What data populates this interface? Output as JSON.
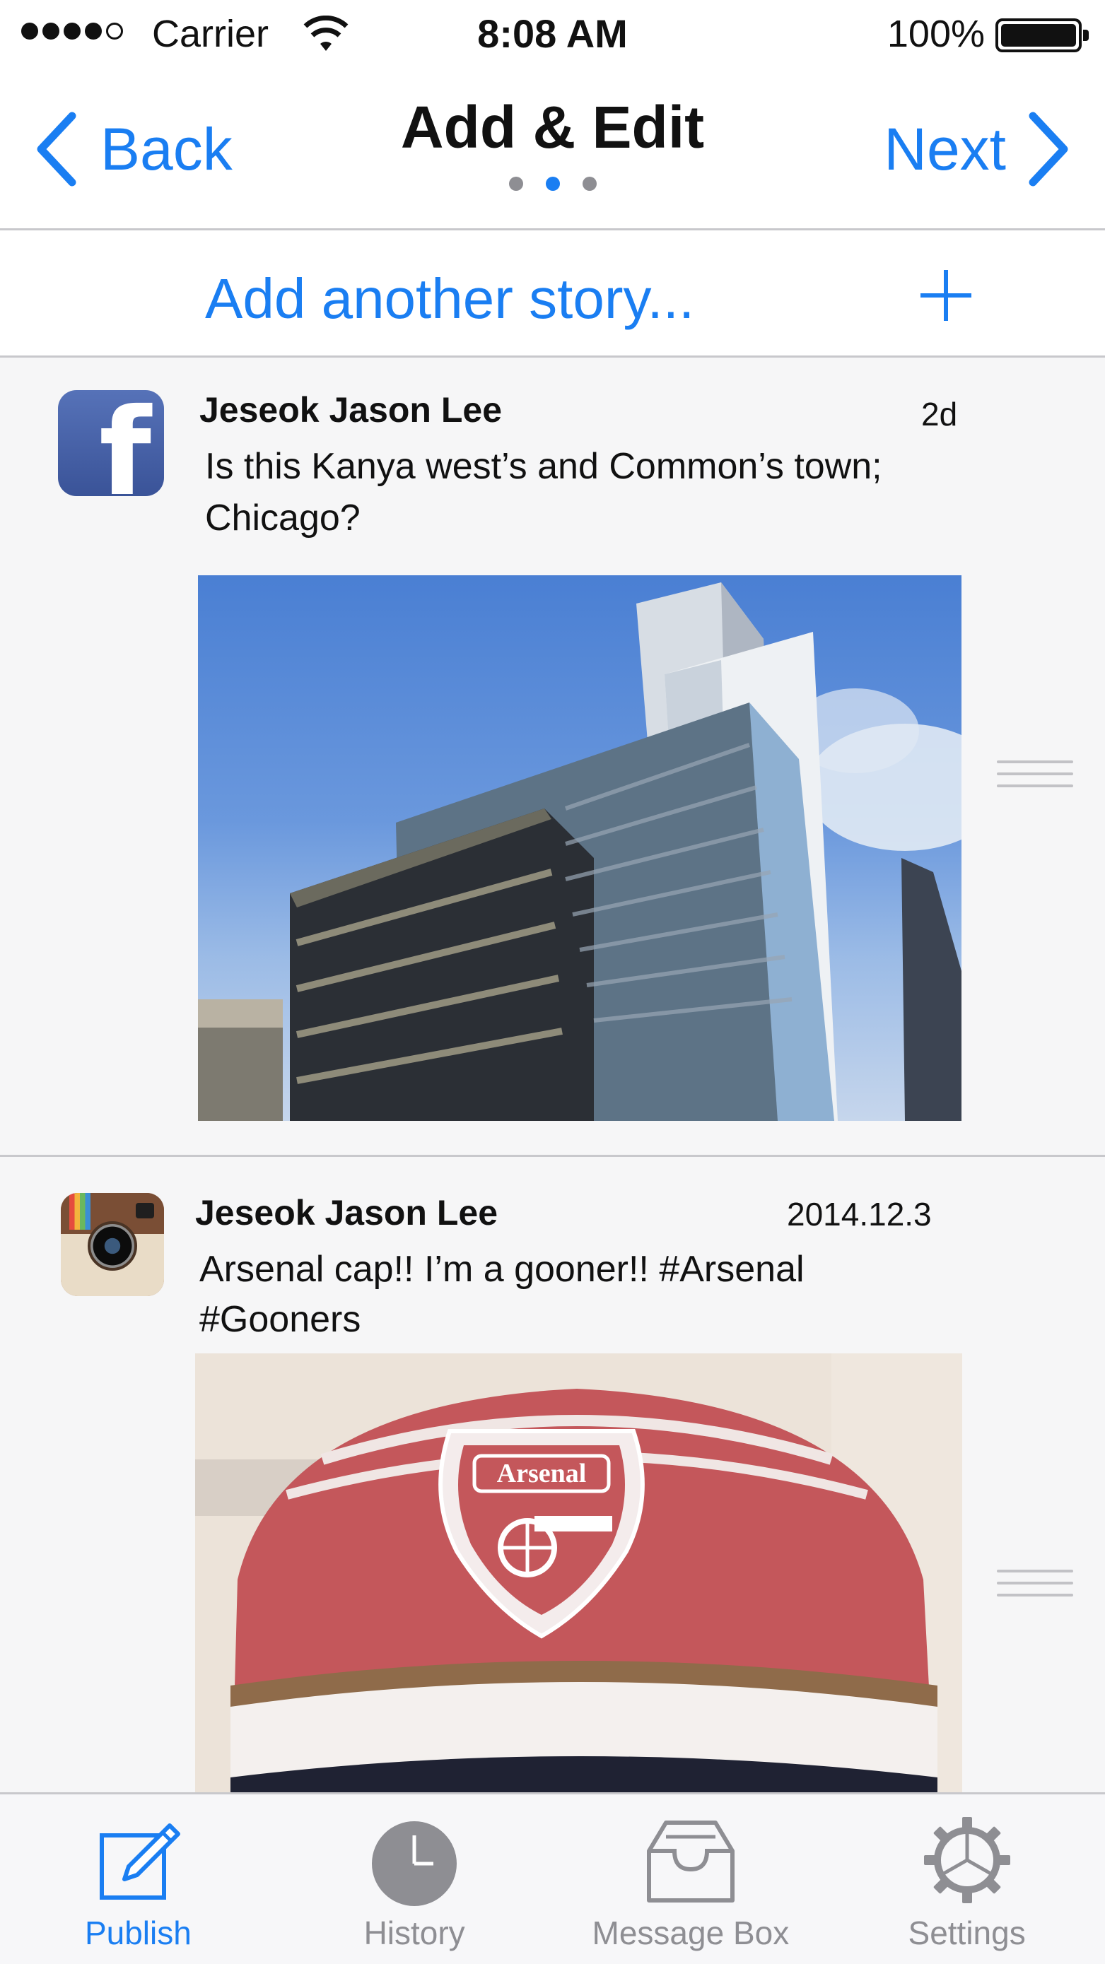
{
  "status_bar": {
    "carrier": "Carrier",
    "time": "8:08 AM",
    "battery": "100%"
  },
  "nav": {
    "back_label": "Back",
    "title": "Add & Edit",
    "next_label": "Next",
    "page_count": 3,
    "current_page": 2
  },
  "add_row": {
    "label": "Add another story..."
  },
  "stories": [
    {
      "source_icon": "facebook-icon",
      "author": "Jeseok Jason Lee",
      "time": "2d",
      "text_line1": "Is this Kanya west’s and Common’s town;",
      "text_line2": "Chicago?"
    },
    {
      "source_icon": "instagram-icon",
      "author": "Jeseok Jason Lee",
      "time": "2014.12.3",
      "text_line1": "Arsenal cap!! I’m a gooner!! #Arsenal",
      "text_line2": "#Gooners",
      "cap_text": "Arsenal"
    }
  ],
  "tabs": [
    {
      "label": "Publish",
      "icon": "compose-icon",
      "active": true
    },
    {
      "label": "History",
      "icon": "clock-icon",
      "active": false
    },
    {
      "label": "Message Box",
      "icon": "inbox-icon",
      "active": false
    },
    {
      "label": "Settings",
      "icon": "gear-icon",
      "active": false
    }
  ],
  "colors": {
    "accent": "#1a7ef2",
    "inactive": "#8e8e93",
    "separator": "#c8c8cc"
  }
}
